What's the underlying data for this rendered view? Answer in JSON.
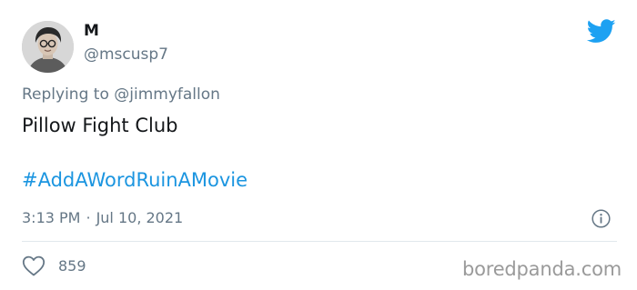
{
  "user": {
    "display_name": "M",
    "handle": "@mscusp7"
  },
  "reply": {
    "prefix": "Replying to",
    "mention": "@jimmyfallon"
  },
  "tweet": {
    "text": "Pillow Fight Club",
    "hashtag": "#AddAWordRuinAMovie",
    "time": "3:13 PM",
    "separator": "·",
    "date": "Jul 10, 2021"
  },
  "engagement": {
    "likes": "859"
  },
  "watermark": "boredpanda.com",
  "icons": {
    "logo": "twitter-bird-icon",
    "info": "info-circle-icon",
    "like": "heart-outline-icon"
  },
  "colors": {
    "brand": "#1da1f2",
    "link": "#1b95e0",
    "secondary_text": "#657786",
    "primary_text": "#14171a"
  }
}
